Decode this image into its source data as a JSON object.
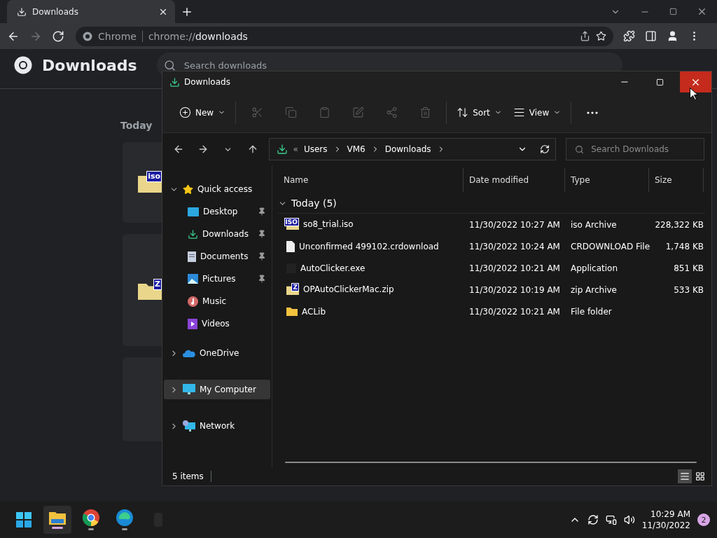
{
  "chrome": {
    "tabs": [
      {
        "title": "Downloads",
        "selected": true
      }
    ],
    "nav": [
      {
        "kind": "back",
        "disabled": false
      },
      {
        "kind": "forward",
        "disabled": true
      },
      {
        "kind": "reload",
        "disabled": false
      }
    ],
    "omnibox": {
      "site": "Chrome",
      "url_prefix": "chrome://",
      "url_path": "downloads"
    },
    "page_title": "Downloads",
    "search": {
      "placeholder": "Search downloads"
    },
    "date_heading": "Today",
    "cards": [
      {
        "kind": "archive",
        "badge": "iso"
      },
      {
        "kind": "archive",
        "badge": "Z"
      },
      {
        "kind": "blank"
      }
    ]
  },
  "explorer": {
    "title": "Downloads",
    "toolbar_groups": [
      [
        {
          "kind": "new",
          "label": "New",
          "disabled": false
        }
      ],
      [
        {
          "kind": "cut",
          "disabled": true
        },
        {
          "kind": "copy",
          "disabled": true
        },
        {
          "kind": "paste",
          "disabled": true
        },
        {
          "kind": "rename",
          "disabled": true
        },
        {
          "kind": "share",
          "disabled": true
        },
        {
          "kind": "delete",
          "disabled": true
        }
      ],
      [
        {
          "kind": "sort",
          "label": "Sort",
          "disabled": false
        },
        {
          "kind": "view",
          "label": "View",
          "disabled": false
        }
      ],
      [
        {
          "kind": "more",
          "disabled": false
        }
      ]
    ],
    "breadcrumb_overflow": "«",
    "breadcrumb": [
      "Users",
      "VM6",
      "Downloads"
    ],
    "search": {
      "placeholder": "Search Downloads"
    },
    "nav": [
      {
        "label": "Quick access",
        "kind": "star",
        "expanded": true,
        "selected": false,
        "children": [
          {
            "label": "Desktop",
            "kind": "desktop",
            "pinned": true,
            "selected": false
          },
          {
            "label": "Downloads",
            "kind": "download",
            "pinned": true,
            "selected": false
          },
          {
            "label": "Documents",
            "kind": "documents",
            "pinned": true,
            "selected": false
          },
          {
            "label": "Pictures",
            "kind": "pictures",
            "pinned": true,
            "selected": false
          },
          {
            "label": "Music",
            "kind": "music",
            "pinned": false,
            "selected": false
          },
          {
            "label": "Videos",
            "kind": "videos",
            "pinned": false,
            "selected": false
          }
        ]
      },
      {
        "label": "OneDrive",
        "kind": "cloud",
        "expanded": false,
        "selected": false
      },
      {
        "label": "My Computer",
        "kind": "computer",
        "expanded": false,
        "selected": true
      },
      {
        "label": "Network",
        "kind": "network",
        "expanded": false,
        "selected": false
      }
    ],
    "columns": [
      "Name",
      "Date modified",
      "Type",
      "Size"
    ],
    "group": {
      "label": "Today (5)",
      "expanded": true
    },
    "rows": [
      {
        "kind": "archive",
        "badge": "ISO",
        "name": "so8_trial.iso",
        "date": "11/30/2022 10:27 AM",
        "type": "iso Archive",
        "size": "228,322 KB"
      },
      {
        "kind": "document",
        "name": "Unconfirmed 499102.crdownload",
        "date": "11/30/2022 10:24 AM",
        "type": "CRDOWNLOAD File",
        "size": "1,748 KB"
      },
      {
        "kind": "app",
        "name": "AutoClicker.exe",
        "date": "11/30/2022 10:21 AM",
        "type": "Application",
        "size": "851 KB"
      },
      {
        "kind": "archive",
        "badge": "Z",
        "name": "OPAutoClickerMac.zip",
        "date": "11/30/2022 10:19 AM",
        "type": "zip Archive",
        "size": "533 KB"
      },
      {
        "kind": "folder",
        "name": "ACLib",
        "date": "11/30/2022 10:21 AM",
        "type": "File folder",
        "size": ""
      }
    ],
    "status": "5 items",
    "views": [
      {
        "kind": "details",
        "selected": true
      },
      {
        "kind": "tiles",
        "selected": false
      }
    ]
  },
  "taskbar": {
    "apps": [
      {
        "kind": "start",
        "running": false,
        "active": false
      },
      {
        "kind": "explorer",
        "running": true,
        "active": true
      },
      {
        "kind": "chrome",
        "running": true,
        "active": false
      },
      {
        "kind": "edge",
        "running": true,
        "active": false
      },
      {
        "kind": "faint",
        "running": false,
        "active": false
      }
    ],
    "time": "10:29 AM",
    "date": "11/30/2022",
    "notifications": "2"
  }
}
